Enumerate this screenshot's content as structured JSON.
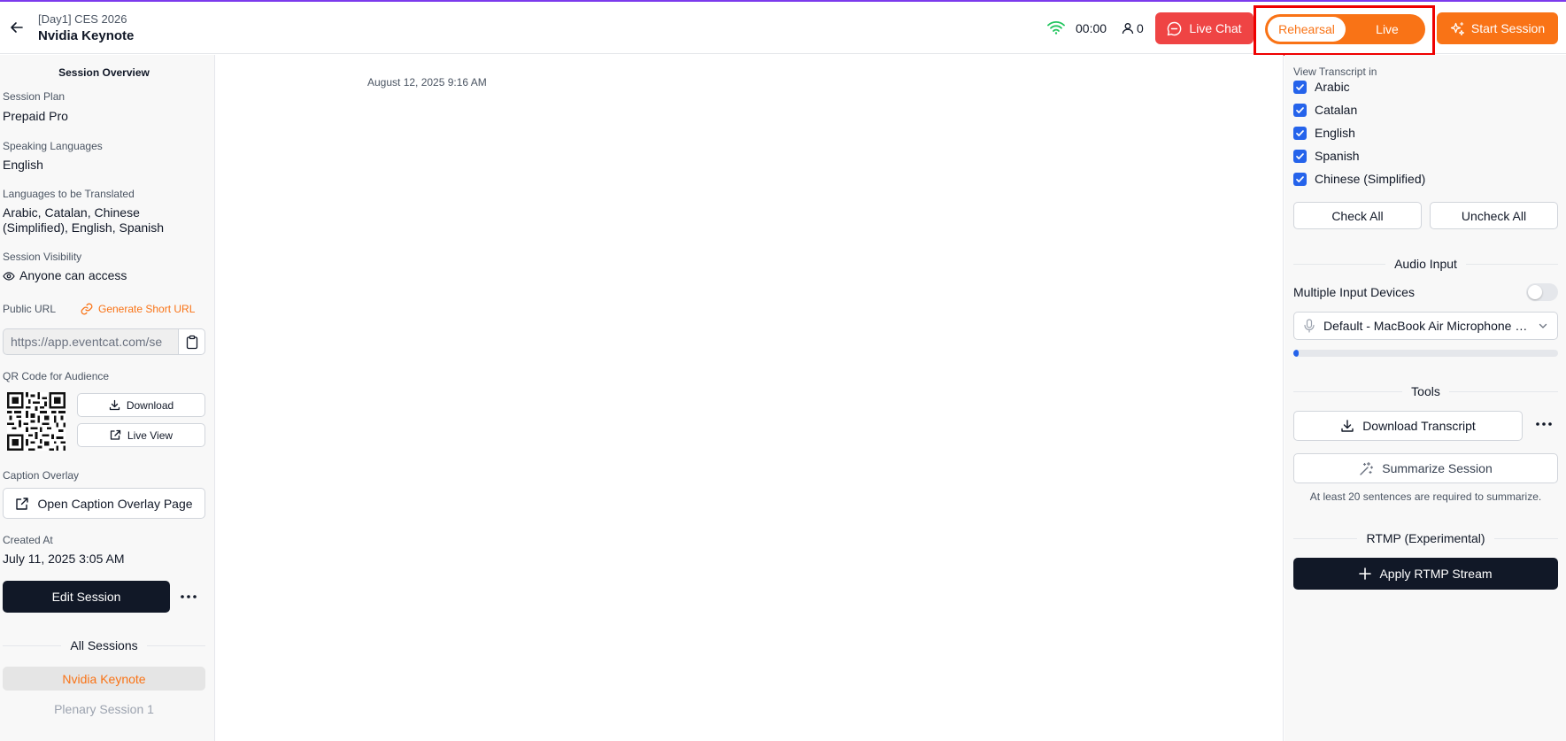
{
  "header": {
    "event": "[Day1] CES 2026",
    "session_title": "Nvidia Keynote",
    "timer": "00:00",
    "audience_count": "0",
    "live_chat_label": "Live Chat",
    "mode_rehearsal": "Rehearsal",
    "mode_live": "Live",
    "start_label": "Start Session",
    "colors": {
      "live_chat": "#ef4444",
      "accent": "#f97316",
      "wifi": "#22c55e"
    }
  },
  "left": {
    "section_title": "Session Overview",
    "plan_label": "Session Plan",
    "plan_value": "Prepaid Pro",
    "speaking_label": "Speaking Languages",
    "speaking_value": "English",
    "translated_label": "Languages to be Translated",
    "translated_line1": "Arabic, Catalan, Chinese",
    "translated_line2": "(Simplified), English, Spanish",
    "visibility_label": "Session Visibility",
    "visibility_value": "Anyone can access",
    "public_url_label": "Public URL",
    "short_url_label": "Generate Short URL",
    "public_url_value": "https://app.eventcat.com/se",
    "qr_label": "QR Code for Audience",
    "download_label": "Download",
    "live_view_label": "Live View",
    "caption_label": "Caption Overlay",
    "caption_button": "Open Caption Overlay Page",
    "created_label": "Created At",
    "created_value": "July 11, 2025 3:05 AM",
    "edit_label": "Edit Session",
    "all_sessions_label": "All Sessions",
    "sessions": [
      "Nvidia Keynote",
      "Plenary Session 1"
    ]
  },
  "main": {
    "timestamp": "August 12, 2025 9:16 AM"
  },
  "right": {
    "view_label": "View Transcript in",
    "languages": [
      "Arabic",
      "Catalan",
      "English",
      "Spanish",
      "Chinese (Simplified)"
    ],
    "check_all": "Check All",
    "uncheck_all": "Uncheck All",
    "audio_title": "Audio Input",
    "multiple_devices_label": "Multiple Input Devices",
    "device_value": "Default - MacBook Air Microphone (Built-in)",
    "audio_level": 0.02,
    "tools_title": "Tools",
    "download_transcript": "Download Transcript",
    "summarize": "Summarize Session",
    "summarize_hint": "At least 20 sentences are required to summarize.",
    "rtmp_title": "RTMP (Experimental)",
    "rtmp_button": "Apply RTMP Stream"
  }
}
